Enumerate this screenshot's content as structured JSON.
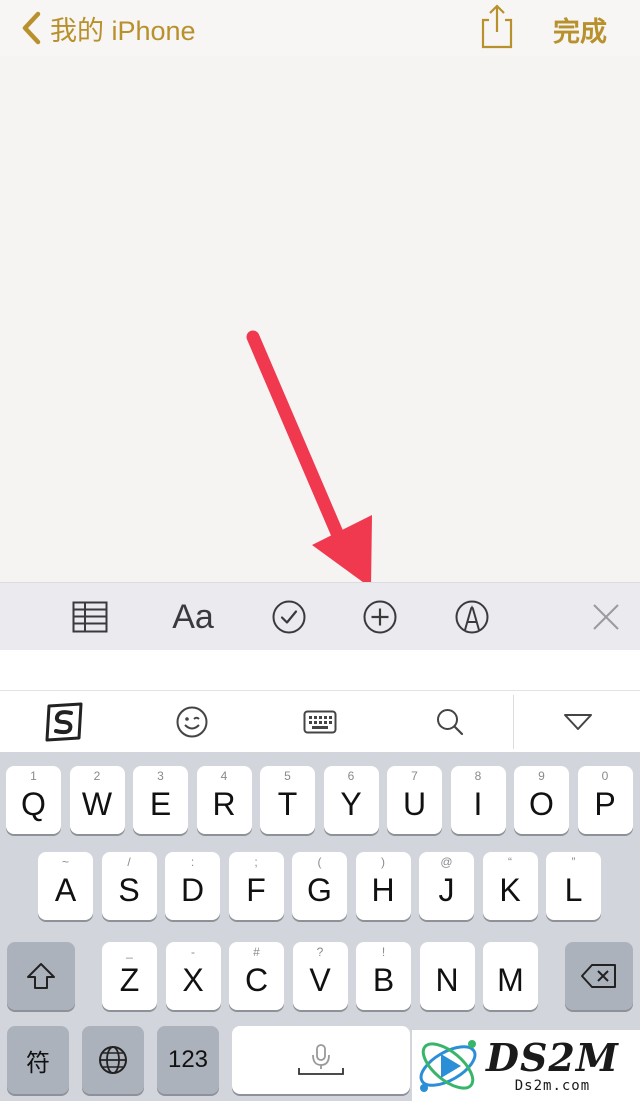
{
  "nav": {
    "back_label": "我的 iPhone",
    "done_label": "完成",
    "accent_color": "#b8902c"
  },
  "toolbar": {
    "items": [
      "table-icon",
      "format-text",
      "checklist-icon",
      "add-icon",
      "markup-icon",
      "close-icon"
    ],
    "format_label": "Aa"
  },
  "annotation": {
    "arrow_color": "#f0384f",
    "points_to": "add-icon"
  },
  "ime_bar": {
    "items": [
      "sogou-logo",
      "emoji-icon",
      "keyboard-icon",
      "search-icon",
      "collapse-icon"
    ]
  },
  "keyboard": {
    "row1": [
      {
        "hint": "1",
        "label": "Q"
      },
      {
        "hint": "2",
        "label": "W"
      },
      {
        "hint": "3",
        "label": "E"
      },
      {
        "hint": "4",
        "label": "R"
      },
      {
        "hint": "5",
        "label": "T"
      },
      {
        "hint": "6",
        "label": "Y"
      },
      {
        "hint": "7",
        "label": "U"
      },
      {
        "hint": "8",
        "label": "I"
      },
      {
        "hint": "9",
        "label": "O"
      },
      {
        "hint": "0",
        "label": "P"
      }
    ],
    "row2": [
      {
        "hint": "~",
        "label": "A"
      },
      {
        "hint": "/",
        "label": "S"
      },
      {
        "hint": ":",
        "label": "D"
      },
      {
        "hint": ";",
        "label": "F"
      },
      {
        "hint": "(",
        "label": "G"
      },
      {
        "hint": ")",
        "label": "H"
      },
      {
        "hint": "@",
        "label": "J"
      },
      {
        "hint": "“",
        "label": "K"
      },
      {
        "hint": "”",
        "label": "L"
      }
    ],
    "row3": [
      {
        "hint": "_",
        "label": "Z"
      },
      {
        "hint": "-",
        "label": "X"
      },
      {
        "hint": "#",
        "label": "C"
      },
      {
        "hint": "?",
        "label": "V"
      },
      {
        "hint": "!",
        "label": "B"
      },
      {
        "hint": "",
        "label": "N"
      },
      {
        "hint": "",
        "label": "M"
      }
    ],
    "symbol_label": "符",
    "numbers_label": "123"
  },
  "watermark": {
    "big": "DS2M",
    "small": "Ds2m.com"
  }
}
